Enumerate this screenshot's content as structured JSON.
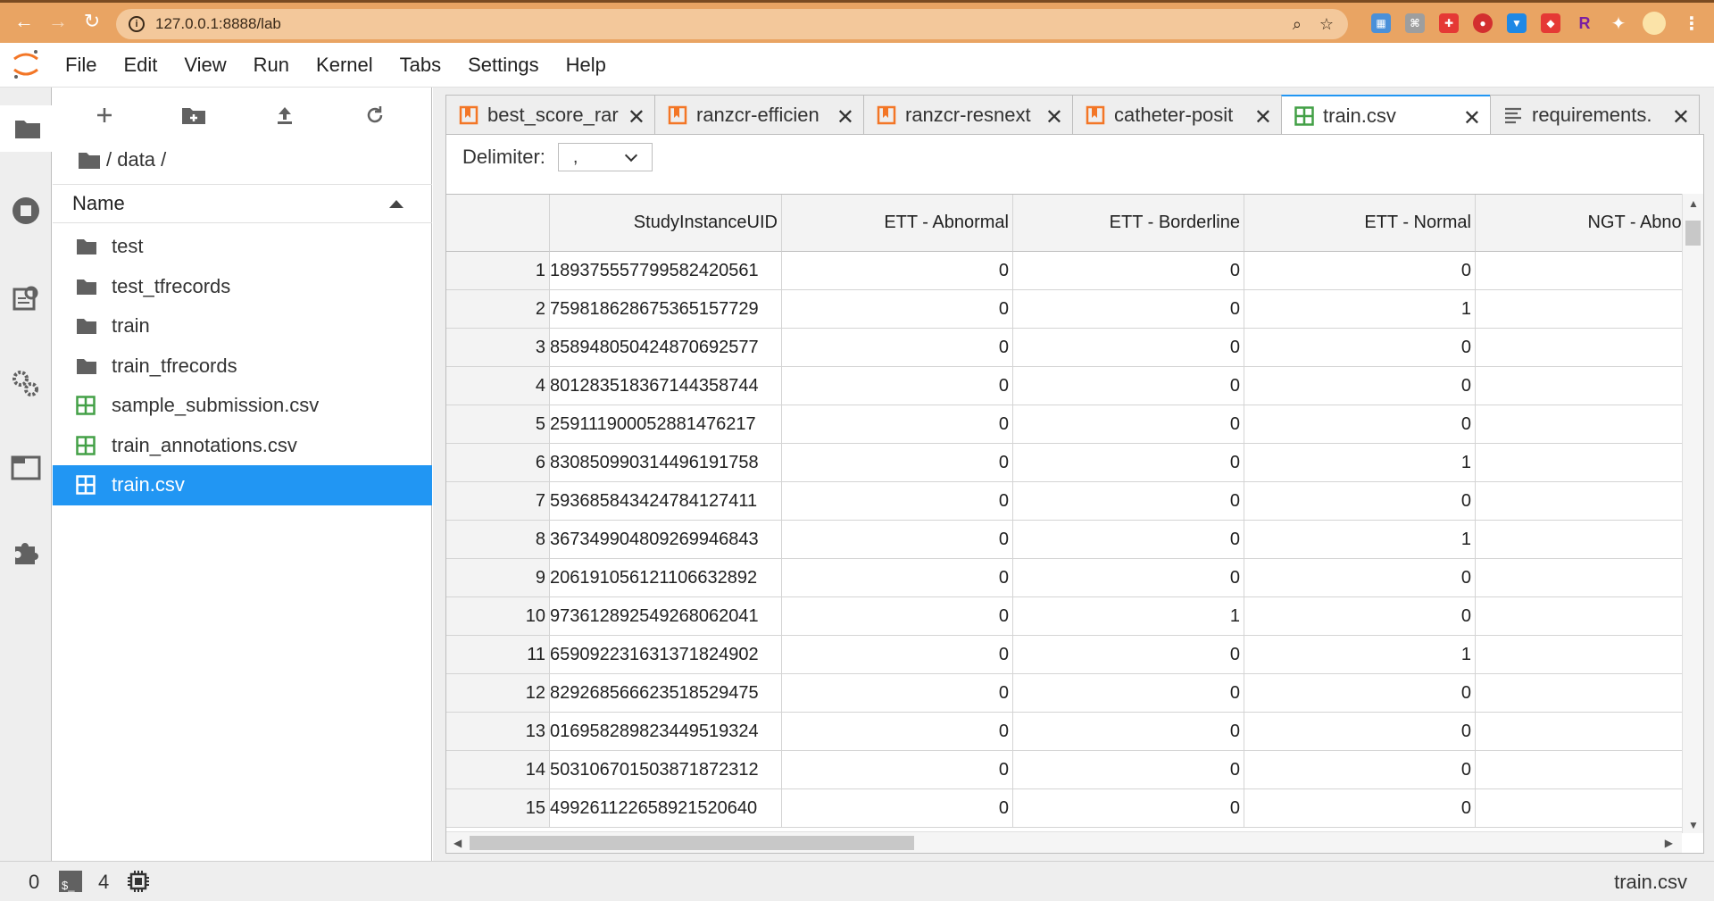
{
  "browser": {
    "url": "127.0.0.1:8888/lab"
  },
  "menu": {
    "items": [
      "File",
      "Edit",
      "View",
      "Run",
      "Kernel",
      "Tabs",
      "Settings",
      "Help"
    ]
  },
  "file_browser": {
    "breadcrumb": "/ data /",
    "header": "Name",
    "items": [
      {
        "name": "test",
        "type": "folder"
      },
      {
        "name": "test_tfrecords",
        "type": "folder"
      },
      {
        "name": "train",
        "type": "folder"
      },
      {
        "name": "train_tfrecords",
        "type": "folder"
      },
      {
        "name": "sample_submission.csv",
        "type": "csv"
      },
      {
        "name": "train_annotations.csv",
        "type": "csv"
      },
      {
        "name": "train.csv",
        "type": "csv",
        "selected": true
      }
    ]
  },
  "tabs": [
    {
      "label": "best_score_rar",
      "type": "notebook"
    },
    {
      "label": "ranzcr-efficien",
      "type": "notebook"
    },
    {
      "label": "ranzcr-resnext",
      "type": "notebook"
    },
    {
      "label": "catheter-posit",
      "type": "notebook"
    },
    {
      "label": "train.csv",
      "type": "csv",
      "active": true
    },
    {
      "label": "requirements.",
      "type": "text"
    }
  ],
  "csv_viewer": {
    "delimiter_label": "Delimiter:",
    "delimiter_value": ",",
    "columns": [
      "StudyInstanceUID",
      "ETT - Abnormal",
      "ETT - Borderline",
      "ETT - Normal",
      "NGT - Abnorm"
    ],
    "rows": [
      {
        "n": "1",
        "uid": "189375557799582420561",
        "v": [
          "0",
          "0",
          "0",
          ""
        ]
      },
      {
        "n": "2",
        "uid": "759818628675365157729",
        "v": [
          "0",
          "0",
          "1",
          ""
        ]
      },
      {
        "n": "3",
        "uid": "858948050424870692577",
        "v": [
          "0",
          "0",
          "0",
          ""
        ]
      },
      {
        "n": "4",
        "uid": "801283518367144358744",
        "v": [
          "0",
          "0",
          "0",
          ""
        ]
      },
      {
        "n": "5",
        "uid": "259111900052881476217",
        "v": [
          "0",
          "0",
          "0",
          ""
        ]
      },
      {
        "n": "6",
        "uid": "830850990314496191758",
        "v": [
          "0",
          "0",
          "1",
          ""
        ]
      },
      {
        "n": "7",
        "uid": "593685843424784127411",
        "v": [
          "0",
          "0",
          "0",
          ""
        ]
      },
      {
        "n": "8",
        "uid": "367349904809269946843",
        "v": [
          "0",
          "0",
          "1",
          ""
        ]
      },
      {
        "n": "9",
        "uid": "206191056121106632892",
        "v": [
          "0",
          "0",
          "0",
          ""
        ]
      },
      {
        "n": "10",
        "uid": "973612892549268062041",
        "v": [
          "0",
          "1",
          "0",
          ""
        ]
      },
      {
        "n": "11",
        "uid": "659092231631371824902",
        "v": [
          "0",
          "0",
          "1",
          ""
        ]
      },
      {
        "n": "12",
        "uid": "829268566623518529475",
        "v": [
          "0",
          "0",
          "0",
          ""
        ]
      },
      {
        "n": "13",
        "uid": "016958289823449519324",
        "v": [
          "0",
          "0",
          "0",
          ""
        ]
      },
      {
        "n": "14",
        "uid": "503106701503871872312",
        "v": [
          "0",
          "0",
          "0",
          ""
        ]
      },
      {
        "n": "15",
        "uid": "499261122658921520640",
        "v": [
          "0",
          "0",
          "0",
          ""
        ]
      }
    ]
  },
  "status_bar": {
    "terminals": "0",
    "kernels": "4",
    "current_file": "train.csv"
  },
  "colors": {
    "browser_bar": "#e9a463",
    "accent": "#2196f3",
    "notebook_icon": "#f37626",
    "csv_icon": "#43a047"
  }
}
